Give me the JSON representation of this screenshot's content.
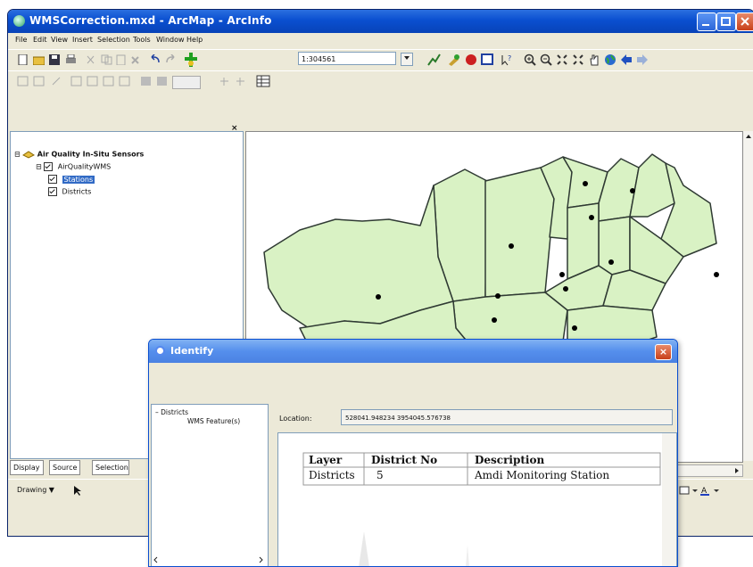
{
  "window": {
    "title": "WMSCorrection.mxd - ArcMap - ArcInfo"
  },
  "menu": [
    "File",
    "Edit",
    "View",
    "Insert",
    "Selection",
    "Tools",
    "Window",
    "Help"
  ],
  "toolbar": {
    "scale_value": "1:304561"
  },
  "toc": {
    "root_layer": "Air Quality In-Situ Sensors",
    "service": "AirQualityWMS",
    "layers": [
      "Stations",
      "Districts"
    ],
    "tabs": [
      "Display",
      "Source",
      "Selection"
    ]
  },
  "draw_toolbar": {
    "drawing_label": "Drawing"
  },
  "identify": {
    "title": "Identify",
    "tree_root": "Districts",
    "tree_child": "WMS Feature(s)",
    "location_label": "Location:",
    "location_value": "528041.948234 3954045.576738",
    "table": {
      "headers": [
        "Layer",
        "District No",
        "Description"
      ],
      "row": [
        "Districts",
        "5",
        "Amdi Monitoring Station"
      ]
    }
  },
  "colors": {
    "district_fill": "#d9f2c4",
    "district_stroke": "#2f3a33",
    "selection": "#316ac5",
    "titlebar": "#0a4fd0"
  }
}
